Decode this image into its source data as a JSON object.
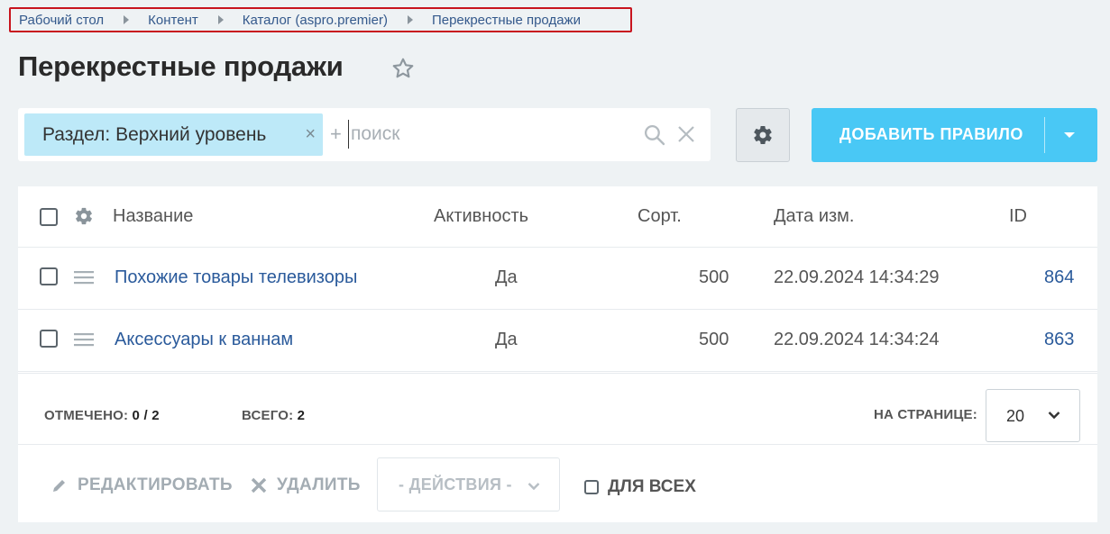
{
  "breadcrumb": [
    {
      "label": "Рабочий стол"
    },
    {
      "label": "Контент"
    },
    {
      "label": "Каталог (aspro.premier)"
    },
    {
      "label": "Перекрестные продажи"
    }
  ],
  "page": {
    "title": "Перекрестные продажи"
  },
  "filter": {
    "chip_label": "Раздел: Верхний уровень",
    "chip_close": "×",
    "plus": "+",
    "search_placeholder": "поиск"
  },
  "toolbar": {
    "add_label": "ДОБАВИТЬ ПРАВИЛО"
  },
  "table": {
    "columns": [
      "Название",
      "Активность",
      "Сорт.",
      "Дата изм.",
      "ID"
    ],
    "rows": [
      {
        "name": "Похожие товары телевизоры",
        "active": "Да",
        "sort": "500",
        "date": "22.09.2024 14:34:29",
        "id": "864"
      },
      {
        "name": "Аксессуары к ваннам",
        "active": "Да",
        "sort": "500",
        "date": "22.09.2024 14:34:24",
        "id": "863"
      }
    ]
  },
  "footer": {
    "selected_label": "ОТМЕЧЕНО:",
    "selected_value": "0 / 2",
    "total_label": "ВСЕГО:",
    "total_value": "2",
    "per_page_label": "НА СТРАНИЦЕ:",
    "per_page_value": "20"
  },
  "actions": {
    "edit_label": "РЕДАКТИРОВАТЬ",
    "delete_label": "УДАЛИТЬ",
    "actions_select": "- ДЕЙСТВИЯ -",
    "for_all_label": "ДЛЯ ВСЕХ"
  },
  "colors": {
    "accent": "#49c8f5",
    "chip": "#bde9f8",
    "link": "#2a5a9b",
    "breadcrumb_highlight": "#c8141e"
  },
  "icons": [
    "star-icon",
    "search-icon",
    "clear-icon",
    "gear-icon",
    "drag-handle-icon",
    "pencil-icon",
    "close-icon",
    "chevron-down-icon",
    "caret-down-icon"
  ]
}
